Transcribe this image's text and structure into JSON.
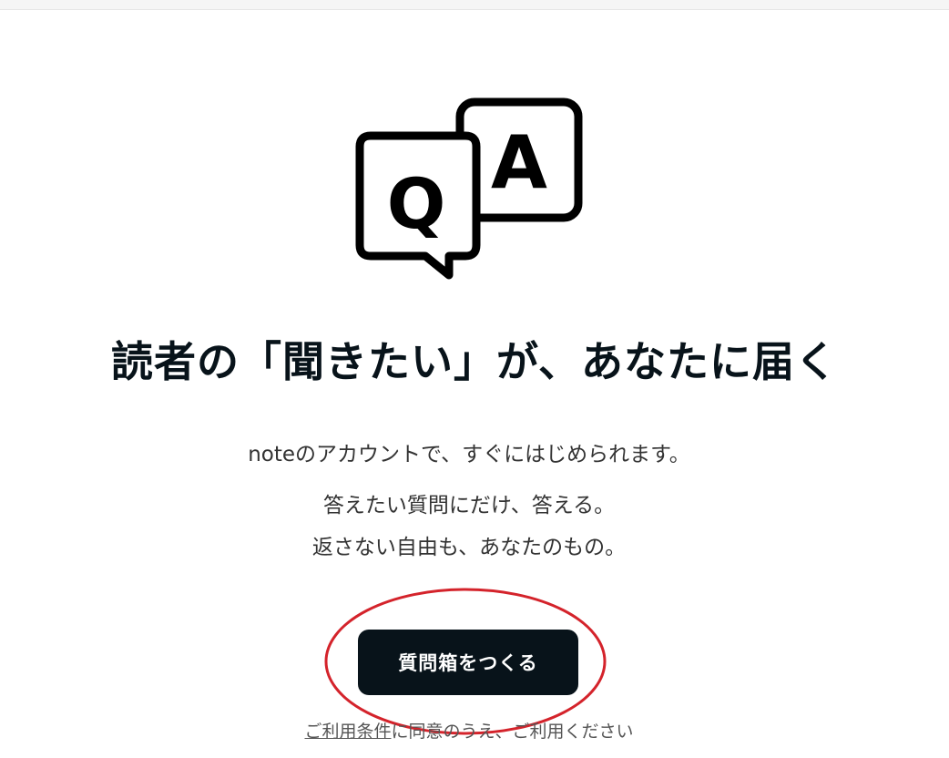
{
  "hero": {
    "icon": "qa-speech-bubbles-icon",
    "question_letter": "Q",
    "answer_letter": "A",
    "headline": "読者の「聞きたい」が、あなたに届く"
  },
  "description": {
    "line1": "noteのアカウントで、すぐにはじめられます。",
    "line2": "答えたい質問にだけ、答える。",
    "line3": "返さない自由も、あなたのもの。"
  },
  "cta": {
    "label": "質問箱をつくる",
    "button_color": "#08131a",
    "highlight_color": "#d4232b"
  },
  "terms": {
    "link_text": "ご利用条件",
    "rest_text": "に同意のうえ、ご利用ください"
  }
}
